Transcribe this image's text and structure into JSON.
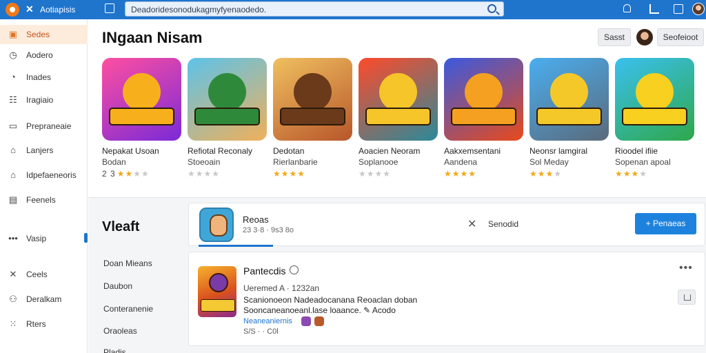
{
  "app": {
    "title": "Aotiapisis",
    "close_glyph": "✕"
  },
  "search": {
    "text": "Deadoridesonodukagmyfyenaodedo."
  },
  "sidebar": {
    "items": [
      {
        "label": "Sedes",
        "icon": "home-icon",
        "active": true
      },
      {
        "label": "Aodero",
        "icon": "clock-icon"
      },
      {
        "label": "Inades",
        "icon": "history-icon"
      },
      {
        "label": "Iragiaio",
        "icon": "list-icon"
      },
      {
        "label": "Prepraneaie",
        "icon": "folder-icon"
      },
      {
        "label": "Lanjers",
        "icon": "tag-icon"
      },
      {
        "label": "Idpefaeneoris",
        "icon": "home-outline-icon"
      },
      {
        "label": "Feenels",
        "icon": "calendar-icon"
      },
      {
        "label": "Vasip",
        "icon": "more-dots-icon"
      },
      {
        "label": "Ceels",
        "icon": "tools-icon"
      },
      {
        "label": "Deralkam",
        "icon": "people-icon"
      },
      {
        "label": "Rters",
        "icon": "grid-icon"
      }
    ]
  },
  "header": {
    "title": "INgaan Nisam",
    "button1": "Sasst",
    "button2": "Seofeioot"
  },
  "games": [
    {
      "name": "Nepakat Usoan",
      "sub": "Bodan",
      "rating_text": "2 3",
      "stars": 2,
      "colors": [
        "#ff4fa0",
        "#7a2ad8",
        "#f7b01c"
      ]
    },
    {
      "name": "Refiotal Reconaly",
      "sub": "Stoeoain",
      "rating_text": "",
      "stars": 0,
      "colors": [
        "#5cc3ea",
        "#f0b05a",
        "#2e8a3a"
      ]
    },
    {
      "name": "Dedotan",
      "sub": "Rierlanbarie",
      "rating_text": "",
      "stars": 4,
      "colors": [
        "#f0c060",
        "#b8562a",
        "#6a3a1a"
      ]
    },
    {
      "name": "Aoacien Neoram",
      "sub": "Soplanooe",
      "rating_text": "",
      "stars": 0,
      "colors": [
        "#ff4a2a",
        "#2a8a9a",
        "#f5c52a"
      ]
    },
    {
      "name": "Aakxemsentani",
      "sub": "Aandena",
      "rating_text": "",
      "stars": 4,
      "colors": [
        "#3a5ae0",
        "#e84a1a",
        "#f5a020"
      ]
    },
    {
      "name": "Neonsr lamgiral",
      "sub": "Sol Meday",
      "rating_text": "",
      "stars": 3,
      "colors": [
        "#4aaef0",
        "#5a6a7a",
        "#f5c82a"
      ]
    },
    {
      "name": "Rioodel ifiie",
      "sub": "Sopenan apoal",
      "rating_text": "",
      "stars": 3,
      "colors": [
        "#3ac0f0",
        "#2ea84a",
        "#f7d020"
      ]
    }
  ],
  "lower": {
    "section_title": "Vleaft",
    "menu": [
      "Doan Mieans",
      "Daubon",
      "Conteranenie",
      "Oraoleas",
      "Pladis"
    ]
  },
  "panel1": {
    "name": "Reoas",
    "meta": "23 3·8 · 9s3 8o",
    "close_glyph": "✕",
    "status": "Senodid",
    "button": "Penaeas"
  },
  "panel2": {
    "title": "Pantecdis",
    "meta": "Ueremed A · 1232an",
    "desc": "Scanionoeon Nadeadocanana Reoaclan doban Sooncaneanoeanl.lase loaance. ✎ Acodo",
    "link": "Neaneaniernis",
    "foot": "S/S ·  ·  C0l",
    "more_glyph": "•••"
  }
}
